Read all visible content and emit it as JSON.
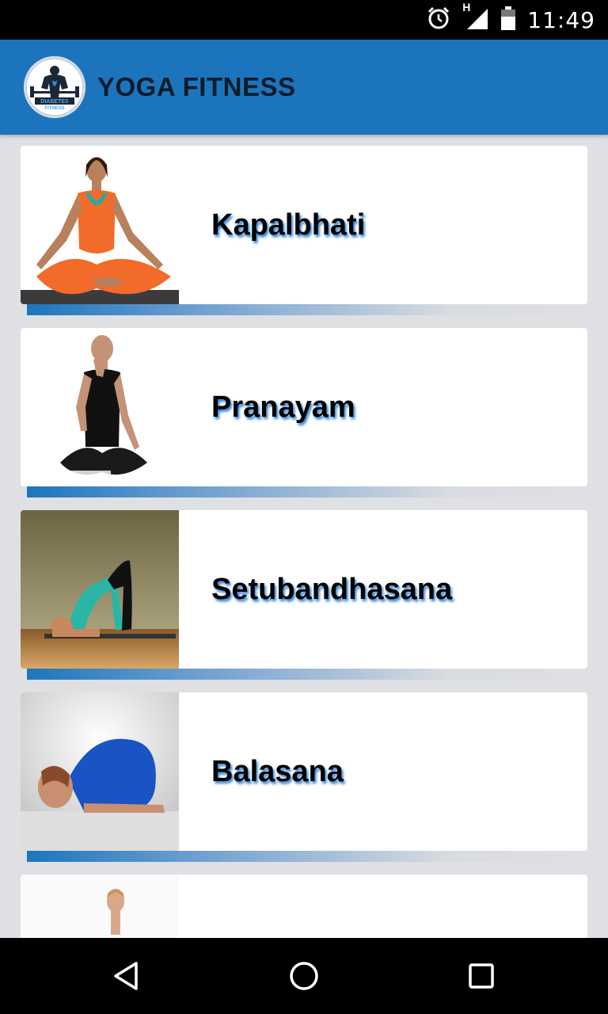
{
  "status_bar": {
    "time": "11:49",
    "network_type": "H",
    "icons": [
      "alarm-icon",
      "signal-icon",
      "battery-icon"
    ]
  },
  "app_bar": {
    "title": "YOGA FITNESS",
    "logo_text": "DIABETES FITNESS",
    "background": "#1c75bc"
  },
  "exercises": [
    {
      "name": "Kapalbhati"
    },
    {
      "name": "Pranayam"
    },
    {
      "name": "Setubandhasana"
    },
    {
      "name": "Balasana"
    },
    {
      "name": ""
    }
  ],
  "nav_bar": {
    "icons": [
      "back-icon",
      "home-icon",
      "recents-icon"
    ]
  }
}
